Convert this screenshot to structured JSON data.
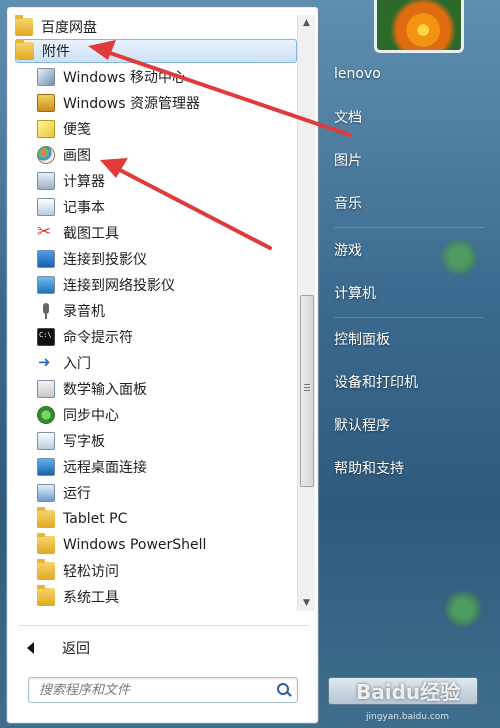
{
  "programs": {
    "folders": [
      {
        "label": "百度网盘",
        "icon": "folder-icon"
      },
      {
        "label": "附件",
        "icon": "folder-icon"
      }
    ],
    "accessories": [
      {
        "label": "Windows 移动中心",
        "icon": "mobility-center-icon"
      },
      {
        "label": "Windows 资源管理器",
        "icon": "explorer-icon"
      },
      {
        "label": "便笺",
        "icon": "sticky-notes-icon"
      },
      {
        "label": "画图",
        "icon": "paint-icon"
      },
      {
        "label": "计算器",
        "icon": "calculator-icon"
      },
      {
        "label": "记事本",
        "icon": "notepad-icon"
      },
      {
        "label": "截图工具",
        "icon": "snipping-tool-icon"
      },
      {
        "label": "连接到投影仪",
        "icon": "projector-icon"
      },
      {
        "label": "连接到网络投影仪",
        "icon": "network-projector-icon"
      },
      {
        "label": "录音机",
        "icon": "microphone-icon"
      },
      {
        "label": "命令提示符",
        "icon": "command-prompt-icon"
      },
      {
        "label": "入门",
        "icon": "getting-started-icon"
      },
      {
        "label": "数学输入面板",
        "icon": "math-input-icon"
      },
      {
        "label": "同步中心",
        "icon": "sync-center-icon"
      },
      {
        "label": "写字板",
        "icon": "wordpad-icon"
      },
      {
        "label": "远程桌面连接",
        "icon": "remote-desktop-icon"
      },
      {
        "label": "运行",
        "icon": "run-icon"
      },
      {
        "label": "Tablet PC",
        "icon": "folder-icon"
      },
      {
        "label": "Windows PowerShell",
        "icon": "folder-icon"
      },
      {
        "label": "轻松访问",
        "icon": "folder-icon"
      },
      {
        "label": "系统工具",
        "icon": "folder-icon"
      }
    ]
  },
  "back_label": "返回",
  "search": {
    "placeholder": "搜索程序和文件"
  },
  "right_menu": {
    "user": "lenovo",
    "items": [
      "文档",
      "图片",
      "音乐",
      "游戏",
      "计算机",
      "控制面板",
      "设备和打印机",
      "默认程序",
      "帮助和支持"
    ]
  },
  "watermark": {
    "text": "Baidu经验",
    "sub": "jingyan.baidu.com"
  },
  "colors": {
    "annotation_arrow": "#e03a3a",
    "selection": "#cbe1f7"
  }
}
